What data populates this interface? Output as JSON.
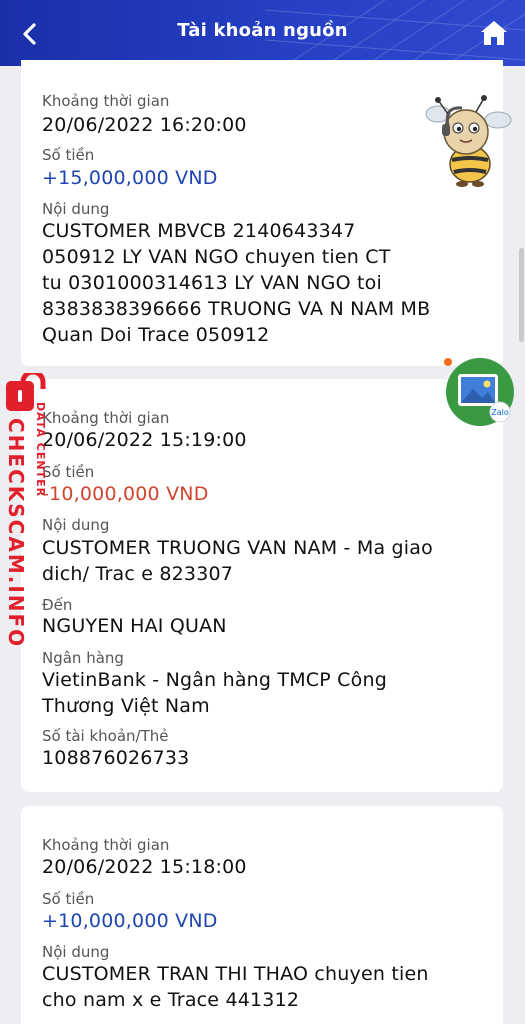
{
  "header": {
    "title": "Tài khoản nguồn",
    "back_icon": "chevron-left-icon",
    "home_icon": "home-icon"
  },
  "transactions": [
    {
      "time_label": "Khoảng thời gian",
      "time": "20/06/2022 16:20:00",
      "amount_label": "Số tiền",
      "amount": "+15,000,000 VND",
      "content_label": "Nội dung",
      "content_lines": [
        "CUSTOMER MBVCB 2140643347",
        "050912 LY VAN NGO  chuyen tien CT",
        "tu 0301000314613 LY  VAN NGO toi",
        "8383838396666 TRUONG VA N NAM  MB",
        "Quan Doi Trace 050912"
      ]
    },
    {
      "time_label": "Khoảng thời gian",
      "time": "20/06/2022 15:19:00",
      "amount_label": "Số tiền",
      "amount": "-10,000,000 VND",
      "content_label": "Nội dung",
      "content_lines": [
        "CUSTOMER TRUONG VAN NAM - Ma giao",
        "dich/ Trac e 823307"
      ],
      "to_label": "Đến",
      "to": "NGUYEN HAI QUAN",
      "bank_label": "Ngân hàng",
      "bank_lines": [
        "VietinBank - Ngân hàng TMCP Công",
        "Thương Việt Nam"
      ],
      "account_label": "Số tài khoản/Thẻ",
      "account": "108876026733"
    },
    {
      "time_label": "Khoảng thời gian",
      "time": "20/06/2022 15:18:00",
      "amount_label": "Số tiền",
      "amount": "+10,000,000 VND",
      "content_label": "Nội dung",
      "content_lines": [
        "CUSTOMER TRAN THI THAO chuyen tien",
        "cho nam x e Trace 441312"
      ]
    }
  ],
  "floating": {
    "zalo_label": "Zalo"
  },
  "watermark": {
    "main": "CHECKSCAM.INFO",
    "sub": "DATA CENTER"
  },
  "colors": {
    "header": "#2540c4",
    "positive": "#1f45b5",
    "negative": "#d0452c",
    "watermark": "#e0202a"
  }
}
